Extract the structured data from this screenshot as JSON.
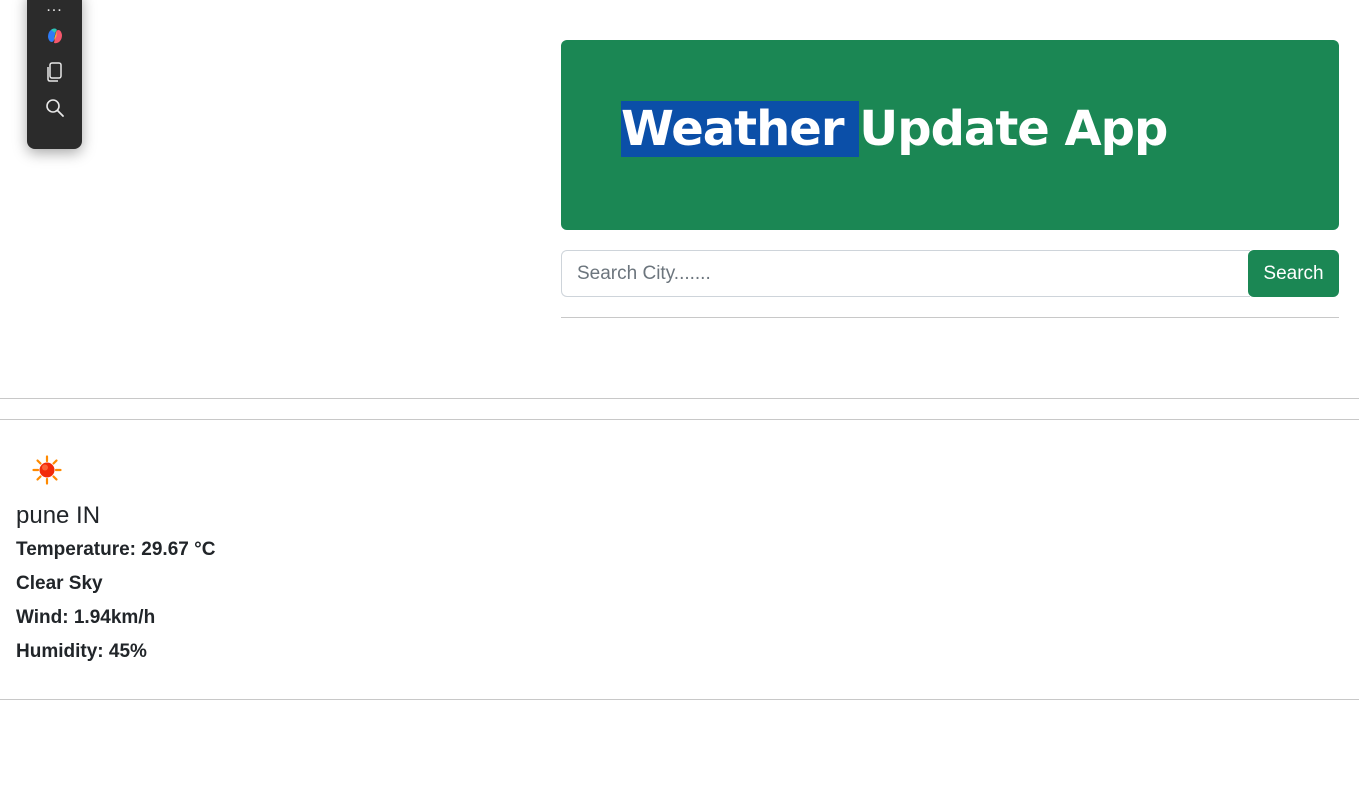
{
  "toolbar": {
    "more_label": "...",
    "icons": [
      "copilot-icon",
      "copy-icon",
      "search-icon"
    ]
  },
  "header": {
    "title_selected": "Weather ",
    "title_rest": "Update App"
  },
  "search": {
    "placeholder": "Search City.......",
    "value": "",
    "button_label": "Search"
  },
  "weather": {
    "icon": "sun-icon",
    "city": "pune IN",
    "temperature": "Temperature: 29.67 °C",
    "description": "Clear Sky",
    "wind": "Wind: 1.94km/h",
    "humidity": "Humidity: 45%"
  },
  "colors": {
    "brand_green": "#1b8754",
    "selection_blue": "#0b4fa8",
    "toolbar_bg": "#2b2b2b"
  }
}
